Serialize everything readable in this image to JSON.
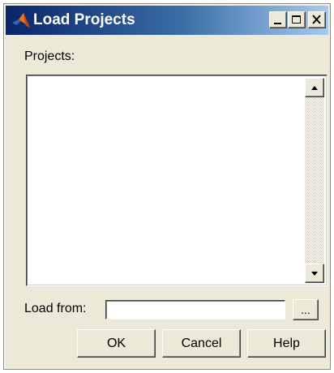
{
  "window": {
    "title": "Load Projects",
    "caption_buttons": [
      "minimize",
      "maximize",
      "close"
    ]
  },
  "projects": {
    "label": "Projects:",
    "items": []
  },
  "load_from": {
    "label": "Load from:",
    "value": "",
    "browse_label": "..."
  },
  "buttons": {
    "ok": "OK",
    "cancel": "Cancel",
    "help": "Help"
  },
  "icons": {
    "app": "matlab-logo-icon",
    "minimize": "minimize-icon",
    "maximize": "maximize-icon",
    "close": "close-icon",
    "scroll_up": "arrow-up-icon",
    "scroll_down": "arrow-down-icon"
  },
  "colors": {
    "titlebar_start": "#0a246a",
    "titlebar_end": "#a6caf0",
    "face": "#ece9d8"
  }
}
